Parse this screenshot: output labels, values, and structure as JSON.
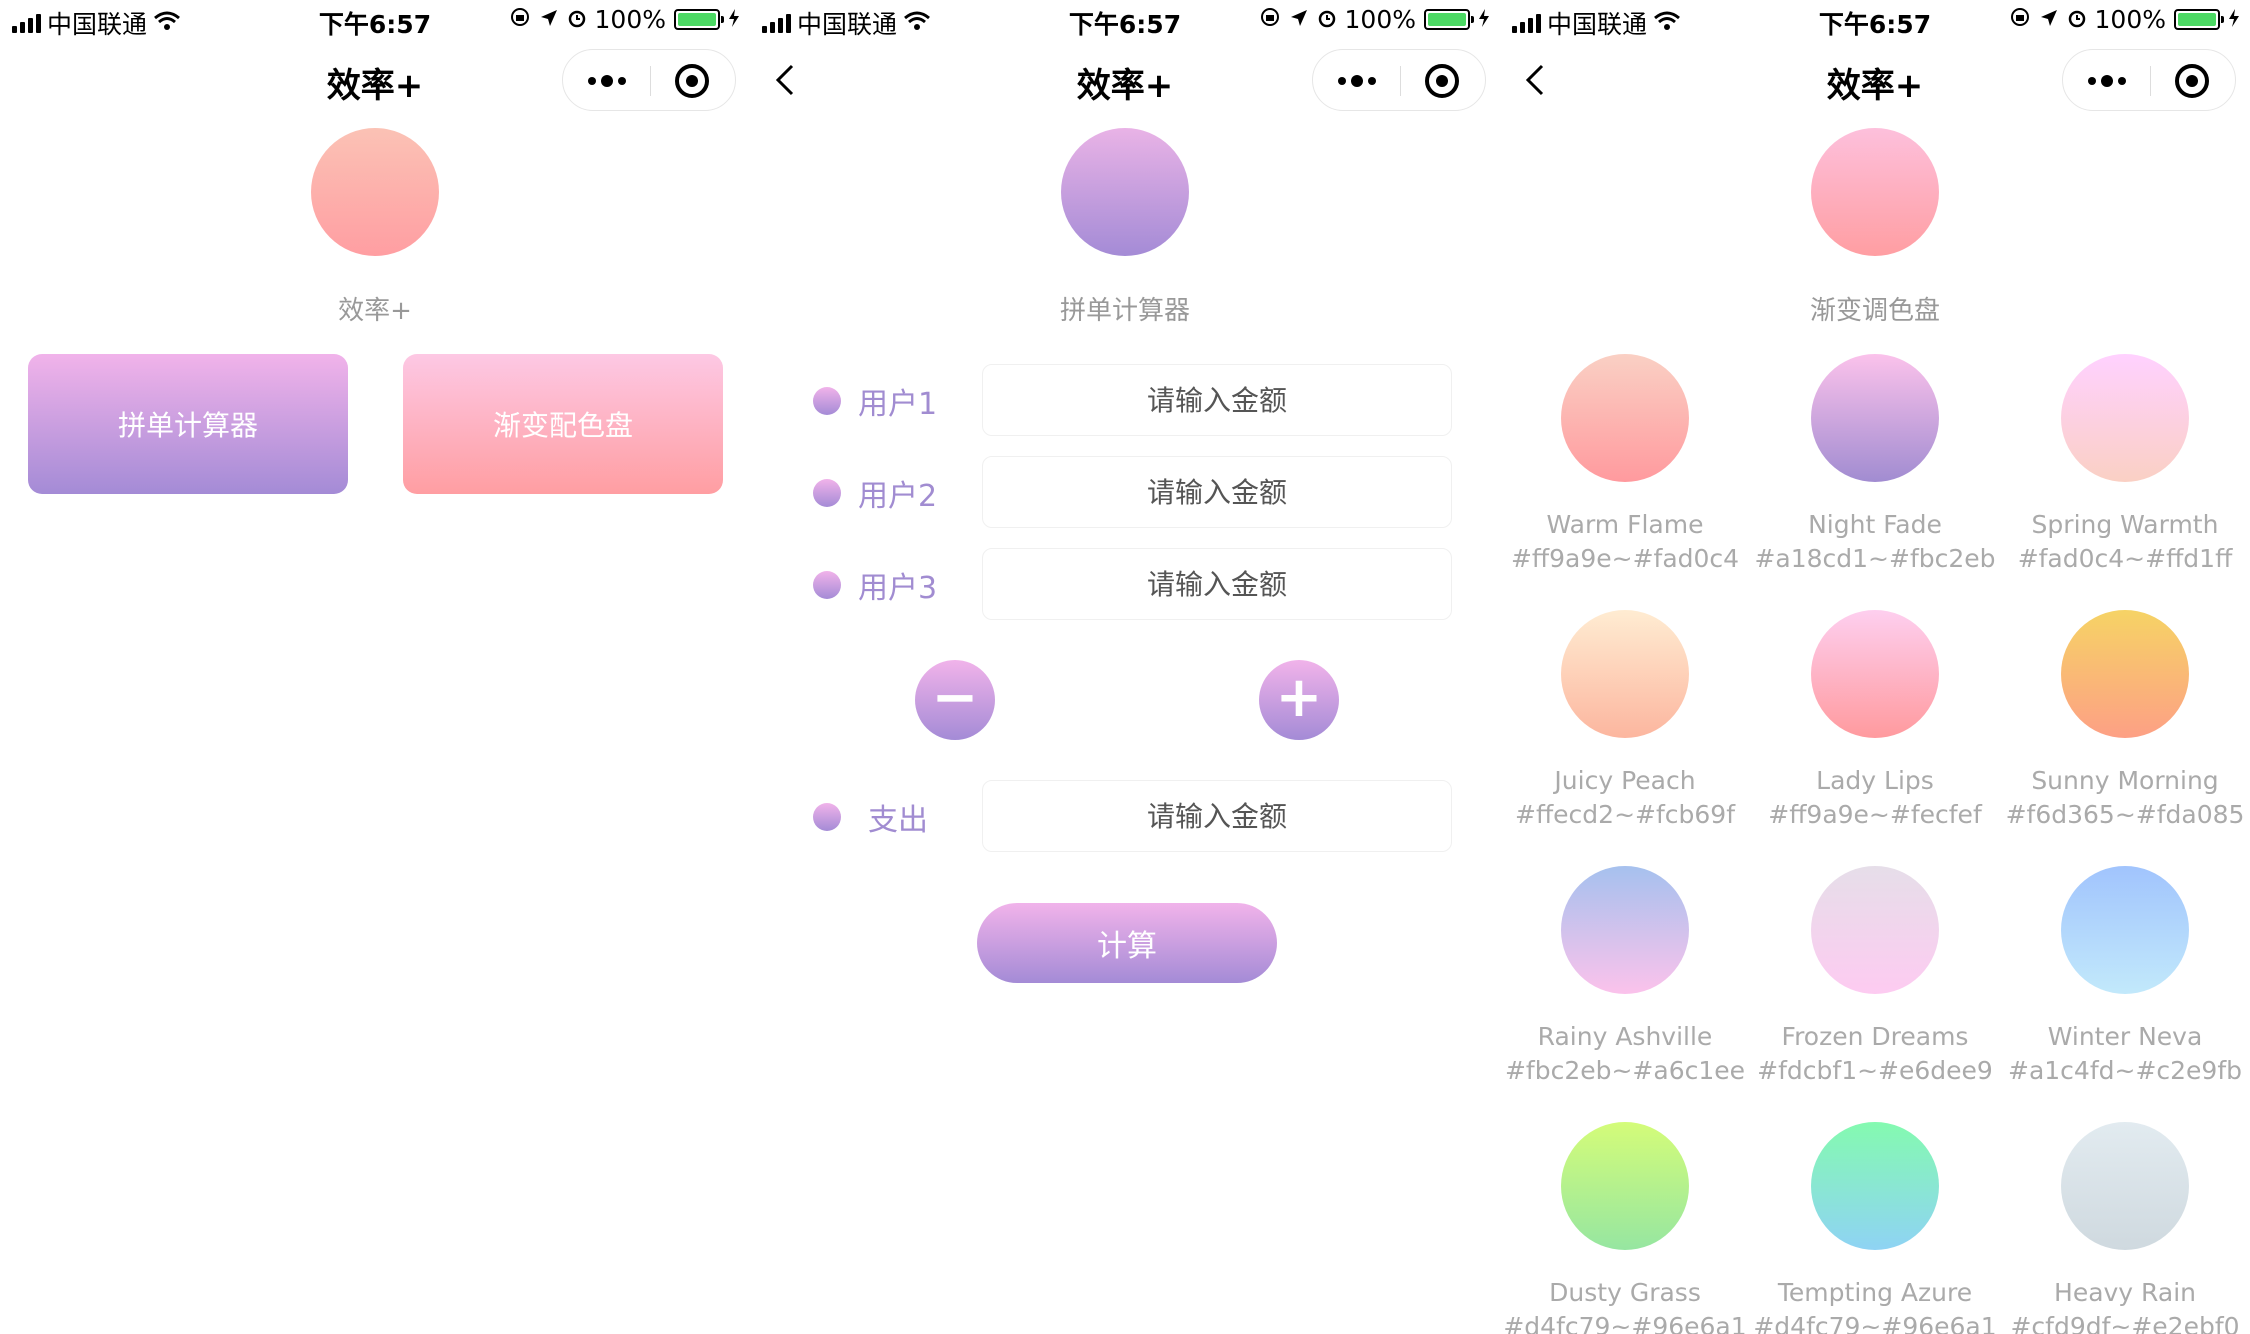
{
  "status_bar": {
    "carrier": "中国联通",
    "time": "下午6:57",
    "battery": "100%"
  },
  "nav": {
    "title": "效率+"
  },
  "home": {
    "hero_label": "效率+",
    "hero_colors": [
      "#fbc2b5",
      "#ff9ea2"
    ],
    "buttons": [
      {
        "label": "拼单计算器",
        "colors": [
          "#f1b3ea",
          "#a48bd6"
        ]
      },
      {
        "label": "渐变配色盘",
        "colors": [
          "#fdc8e4",
          "#ff9ea2"
        ]
      }
    ]
  },
  "calculator": {
    "hero_label": "拼单计算器",
    "hero_colors": [
      "#e9b3e6",
      "#a48bd6"
    ],
    "users": [
      {
        "label": "用户1",
        "placeholder": "请输入金额"
      },
      {
        "label": "用户2",
        "placeholder": "请输入金额"
      },
      {
        "label": "用户3",
        "placeholder": "请输入金额"
      }
    ],
    "minus_label": "−",
    "plus_label": "+",
    "expense": {
      "label": "支出",
      "placeholder": "请输入金额"
    },
    "calc_label": "计算"
  },
  "palette": {
    "hero_label": "渐变调色盘",
    "hero_colors": [
      "#fdc0dc",
      "#ff9ea2"
    ],
    "swatches": [
      {
        "name": "Warm Flame",
        "code": "#ff9a9e~#fad0c4",
        "from": "#fad0c4",
        "to": "#ff9a9e"
      },
      {
        "name": "Night Fade",
        "code": "#a18cd1~#fbc2eb",
        "from": "#fbc2eb",
        "to": "#a18cd1"
      },
      {
        "name": "Spring Warmth",
        "code": "#fad0c4~#ffd1ff",
        "from": "#ffd1ff",
        "to": "#fad0c4"
      },
      {
        "name": "Juicy Peach",
        "code": "#ffecd2~#fcb69f",
        "from": "#ffecd2",
        "to": "#fcb69f"
      },
      {
        "name": "Lady Lips",
        "code": "#ff9a9e~#fecfef",
        "from": "#fecfef",
        "to": "#ff9a9e"
      },
      {
        "name": "Sunny Morning",
        "code": "#f6d365~#fda085",
        "from": "#f6d365",
        "to": "#fda085"
      },
      {
        "name": "Rainy Ashville",
        "code": "#fbc2eb~#a6c1ee",
        "from": "#a6c1ee",
        "to": "#fbc2eb"
      },
      {
        "name": "Frozen Dreams",
        "code": "#fdcbf1~#e6dee9",
        "from": "#e6dee9",
        "to": "#fdcbf1"
      },
      {
        "name": "Winter Neva",
        "code": "#a1c4fd~#c2e9fb",
        "from": "#a1c4fd",
        "to": "#c2e9fb"
      },
      {
        "name": "Dusty Grass",
        "code": "#d4fc79~#96e6a1",
        "from": "#d4fc79",
        "to": "#96e6a1"
      },
      {
        "name": "Tempting Azure",
        "code": "#d4fc79~#96e6a1",
        "from": "#84fab0",
        "to": "#8fd3f4"
      },
      {
        "name": "Heavy Rain",
        "code": "#cfd9df~#e2ebf0",
        "from": "#e2ebf0",
        "to": "#cfd9df"
      }
    ]
  }
}
